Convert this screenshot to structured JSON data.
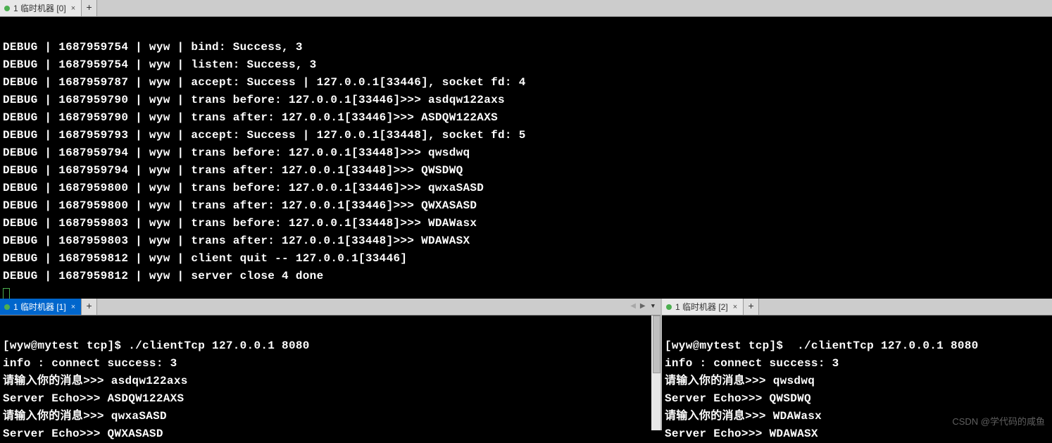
{
  "top_pane": {
    "tab_title": "1 临时机器 [0]",
    "lines": [
      "DEBUG | 1687959754 | wyw | bind: Success, 3",
      "DEBUG | 1687959754 | wyw | listen: Success, 3",
      "DEBUG | 1687959787 | wyw | accept: Success | 127.0.0.1[33446], socket fd: 4",
      "DEBUG | 1687959790 | wyw | trans before: 127.0.0.1[33446]>>> asdqw122axs",
      "DEBUG | 1687959790 | wyw | trans after: 127.0.0.1[33446]>>> ASDQW122AXS",
      "DEBUG | 1687959793 | wyw | accept: Success | 127.0.0.1[33448], socket fd: 5",
      "DEBUG | 1687959794 | wyw | trans before: 127.0.0.1[33448]>>> qwsdwq",
      "DEBUG | 1687959794 | wyw | trans after: 127.0.0.1[33448]>>> QWSDWQ",
      "DEBUG | 1687959800 | wyw | trans before: 127.0.0.1[33446]>>> qwxaSASD",
      "DEBUG | 1687959800 | wyw | trans after: 127.0.0.1[33446]>>> QWXASASD",
      "DEBUG | 1687959803 | wyw | trans before: 127.0.0.1[33448]>>> WDAWasx",
      "DEBUG | 1687959803 | wyw | trans after: 127.0.0.1[33448]>>> WDAWASX",
      "DEBUG | 1687959812 | wyw | client quit -- 127.0.0.1[33446]",
      "DEBUG | 1687959812 | wyw | server close 4 done"
    ]
  },
  "bottom_left": {
    "tab_title": "1 临时机器 [1]",
    "lines": [
      "[wyw@mytest tcp]$ ./clientTcp 127.0.0.1 8080",
      "info : connect success: 3",
      "请输入你的消息>>> asdqw122axs",
      "Server Echo>>> ASDQW122AXS",
      "请输入你的消息>>> qwxaSASD",
      "Server Echo>>> QWXASASD"
    ]
  },
  "bottom_right": {
    "tab_title": "1 临时机器 [2]",
    "lines": [
      "[wyw@mytest tcp]$  ./clientTcp 127.0.0.1 8080",
      "info : connect success: 3",
      "请输入你的消息>>> qwsdwq",
      "Server Echo>>> QWSDWQ",
      "请输入你的消息>>> WDAWasx",
      "Server Echo>>> WDAWASX"
    ]
  },
  "watermark": "CSDN @学代码的咸鱼",
  "close_glyph": "×",
  "add_glyph": "+",
  "arrow_left": "◀",
  "arrow_right": "▶",
  "arrow_down": "▼"
}
